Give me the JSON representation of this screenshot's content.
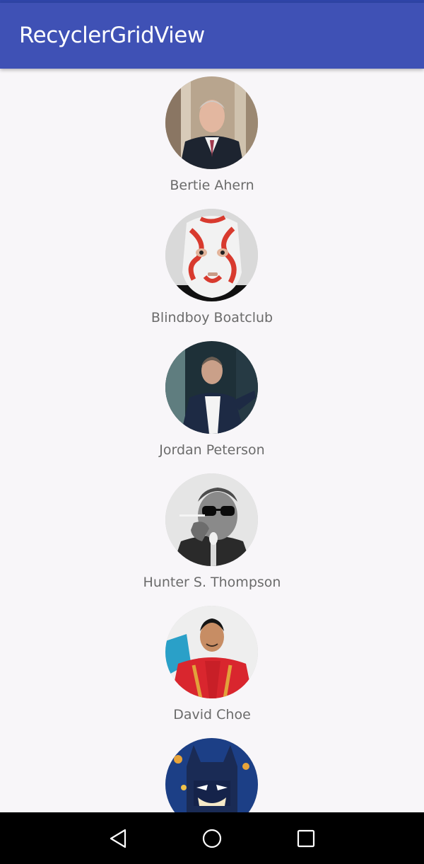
{
  "app": {
    "title": "RecyclerGridView"
  },
  "people": [
    {
      "name": "Bertie Ahern",
      "photo": "portrait-suit-man"
    },
    {
      "name": "Blindboy Boatclub",
      "photo": "portrait-plastic-bag-mask"
    },
    {
      "name": "Jordan Peterson",
      "photo": "portrait-speaker-blazer"
    },
    {
      "name": "Hunter S. Thompson",
      "photo": "portrait-sunglasses-cigarette"
    },
    {
      "name": "David Choe",
      "photo": "portrait-red-jacket"
    },
    {
      "name": "",
      "photo": "lego-batman"
    }
  ],
  "navigation": {
    "back": "back-icon",
    "home": "home-icon",
    "recents": "recents-icon"
  },
  "colors": {
    "primary": "#3f51b5",
    "status_bar": "#2f45a8",
    "background": "#f8f6f9",
    "text": "#6b6b6b"
  }
}
